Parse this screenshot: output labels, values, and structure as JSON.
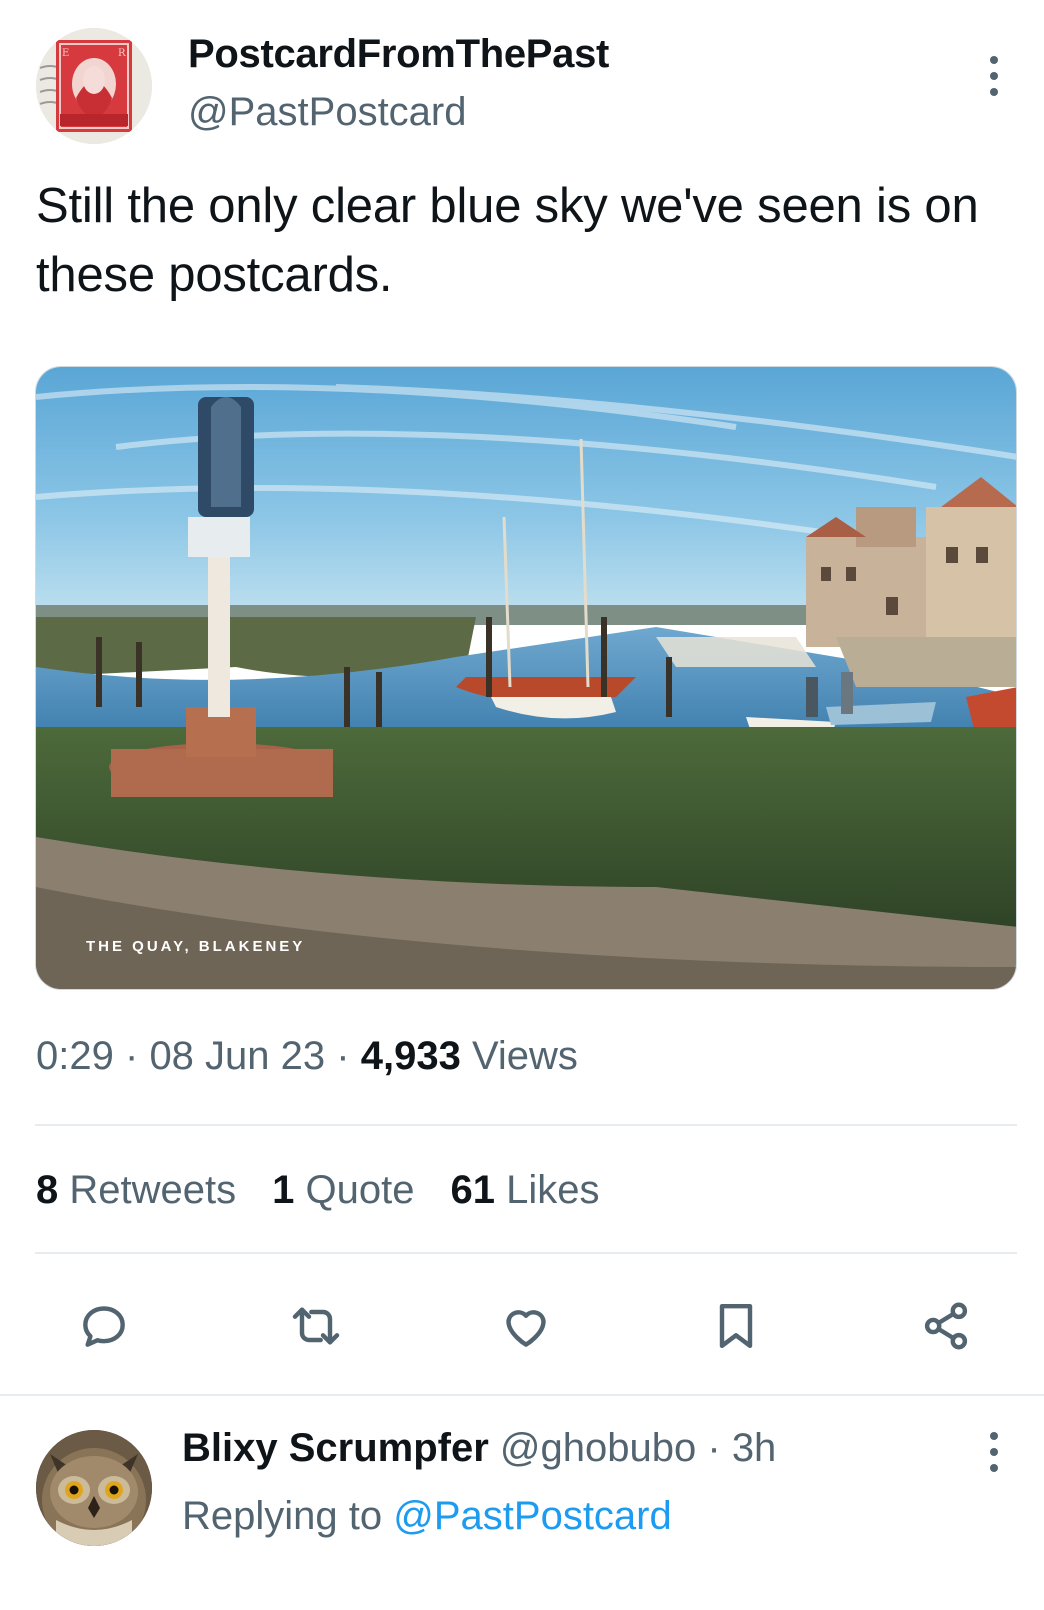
{
  "tweet": {
    "author": {
      "name": "PostcardFromThePast",
      "handle": "@PastPostcard",
      "avatar": "postage-stamp-avatar"
    },
    "text": "Still the only clear blue sky we've seen is on these postcards.",
    "media": {
      "caption": "THE QUAY, BLAKENEY",
      "sign_text": "BLAKENEY"
    },
    "meta": {
      "time": "0:29",
      "separator": "·",
      "date": "08 Jun 23",
      "views_count": "4,933",
      "views_label": "Views"
    },
    "stats": {
      "retweets_count": "8",
      "retweets_label": "Retweets",
      "quotes_count": "1",
      "quotes_label": "Quote",
      "likes_count": "61",
      "likes_label": "Likes"
    },
    "actions": [
      "reply-icon",
      "retweet-icon",
      "heart-icon",
      "bookmark-icon",
      "share-icon"
    ]
  },
  "reply": {
    "name": "Blixy Scrumpfer",
    "handle": "@ghobubo",
    "separator": "·",
    "time": "3h",
    "replying_label": "Replying to",
    "replying_to": "@PastPostcard",
    "avatar": "owl-avatar"
  },
  "colors": {
    "text": "#0f1419",
    "secondary": "#536471",
    "link": "#1d9bf0",
    "divider": "#e6ecf0"
  }
}
